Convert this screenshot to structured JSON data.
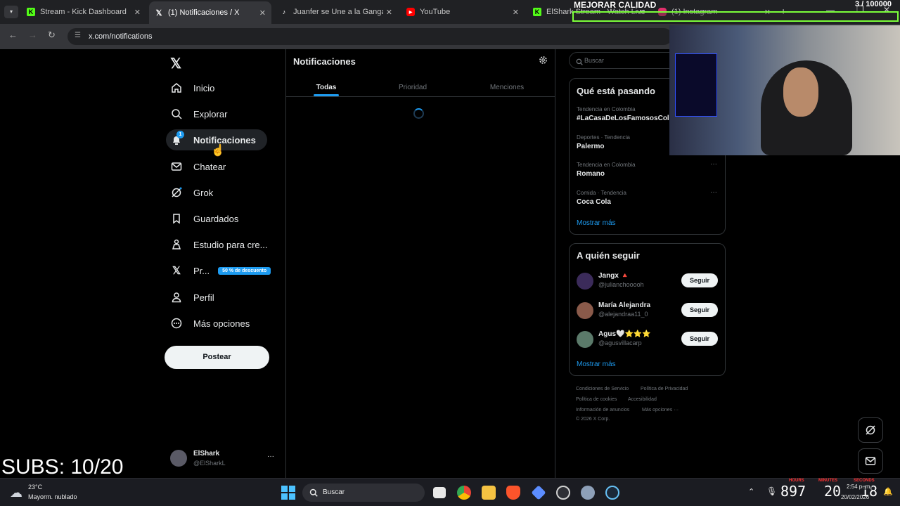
{
  "browser": {
    "tabs": [
      {
        "label": "Stream - Kick Dashboard",
        "icon": "kick-icon",
        "color": "#53fc18"
      },
      {
        "label": "(1) Notificaciones / X",
        "icon": "x-logo-icon",
        "color": "#ffffff"
      },
      {
        "label": "Juanfer se Une a la Ganga de",
        "icon": "tiktok-icon",
        "color": "#ffffff"
      },
      {
        "label": "YouTube",
        "icon": "youtube-icon",
        "color": "#ff0000"
      },
      {
        "label": "ElShark Stream - Watch Live",
        "icon": "kick-icon",
        "color": "#53fc18"
      },
      {
        "label": "(1) Instagram",
        "icon": "instagram-icon",
        "color": "#e1306c"
      }
    ],
    "url": "x.com/notifications"
  },
  "overlay": {
    "quality_label": "MEJORAR CALIDAD",
    "counter": "3 / 100000",
    "subs": "SUBS: 10/20",
    "timer_hours": "897",
    "timer_minutes": "20",
    "timer_seconds": "18",
    "timer_hours_label": "HOURS",
    "timer_minutes_label": "MINUTES",
    "timer_seconds_label": "SECONDS"
  },
  "sidebar": {
    "items": [
      {
        "label": "Inicio",
        "icon": "home-icon"
      },
      {
        "label": "Explorar",
        "icon": "search-icon"
      },
      {
        "label": "Notificaciones",
        "icon": "bell-icon",
        "badge": "1"
      },
      {
        "label": "Chatear",
        "icon": "mail-icon"
      },
      {
        "label": "Grok",
        "icon": "grok-icon"
      },
      {
        "label": "Guardados",
        "icon": "bookmark-icon"
      },
      {
        "label": "Estudio para cre...",
        "icon": "creator-studio-icon"
      },
      {
        "label": "Pr...",
        "icon": "x-premium-icon",
        "badge": "50 % de descuento"
      },
      {
        "label": "Perfil",
        "icon": "person-icon"
      },
      {
        "label": "Más opciones",
        "icon": "more-circle-icon"
      }
    ],
    "post_button": "Postear",
    "account": {
      "name": "ElShark",
      "handle": "@ElSharkL"
    }
  },
  "main": {
    "title": "Notificaciones",
    "tabs": [
      "Todas",
      "Prioridad",
      "Menciones"
    ]
  },
  "right": {
    "search_placeholder": "Buscar",
    "trends_title": "Qué está pasando",
    "trends": [
      {
        "context": "Tendencia en Colombia",
        "title": "#LaCasaDeLosFamososCol"
      },
      {
        "context": "Deportes · Tendencia",
        "title": "Palermo"
      },
      {
        "context": "Tendencia en Colombia",
        "title": "Romano"
      },
      {
        "context": "Comida · Tendencia",
        "title": "Coca Cola"
      }
    ],
    "show_more": "Mostrar más",
    "follow_title": "A quién seguir",
    "follow": [
      {
        "name": "Jangx 🔺",
        "handle": "@julianchooooh",
        "button": "Seguir"
      },
      {
        "name": "María Alejandra",
        "handle": "@alejandraa11_0",
        "button": "Seguir"
      },
      {
        "name": "Agus🤍⭐⭐⭐",
        "handle": "@agusvillacarp",
        "button": "Seguir"
      }
    ],
    "follow_show_more": "Mostrar más",
    "footer": [
      "Condiciones de Servicio",
      "Política de Privacidad",
      "Política de cookies",
      "Accesibilidad",
      "Información de anuncios",
      "Más opciones ···",
      "© 2026 X Corp."
    ]
  },
  "taskbar": {
    "weather_temp": "23°C",
    "weather_desc": "Mayorm. nublado",
    "search_label": "Buscar",
    "time": "2:54 p. m.",
    "date": "20/02/2026"
  },
  "colors": {
    "accent": "#1d9bf0",
    "bg": "#000000",
    "border": "#2f3336"
  }
}
